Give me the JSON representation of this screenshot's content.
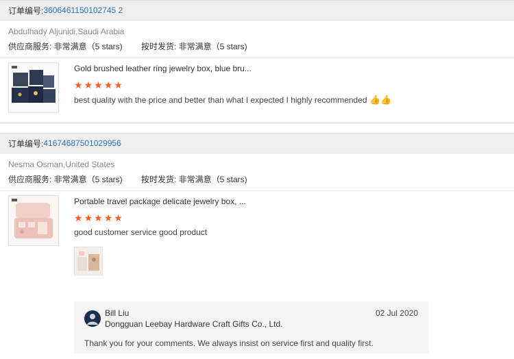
{
  "orders": [
    {
      "order_label": "订单编号:",
      "order_number": "3606461150102745 2",
      "buyer": "Abdulhady Aljunidi,Saudi Arabia",
      "supplier_service": "供应商服务: 非常满意（5 stars)",
      "delivery": "按时发货: 非常满意（5 stars)",
      "product_title": "Gold brushed leather ring jewelry box, blue bru...",
      "stars": 5,
      "review": "best quality with the price and better than what I expected I highly recommended",
      "emoji": "👍👍"
    },
    {
      "order_label": "订单编号:",
      "order_number": "41674687501029956",
      "buyer": "Nesma Osman,United States",
      "supplier_service": "供应商服务: 非常满意（5 stars)",
      "delivery": "按时发货: 非常满意（5 stars)",
      "product_title": "Portable travel package delicate jewelry box, ...",
      "stars": 5,
      "review": "good customer service good product",
      "reply": {
        "name": "Bill Liu",
        "company": "Dongguan Leebay Hardware Craft Gifts Co., Ltd.",
        "date": "02 Jul 2020",
        "text": "Thank you for your comments. We always insist on service first and quality first."
      }
    }
  ],
  "colors": {
    "link": "#2f6fb6",
    "star": "#ff5e1f",
    "header_bg": "#efefef"
  }
}
